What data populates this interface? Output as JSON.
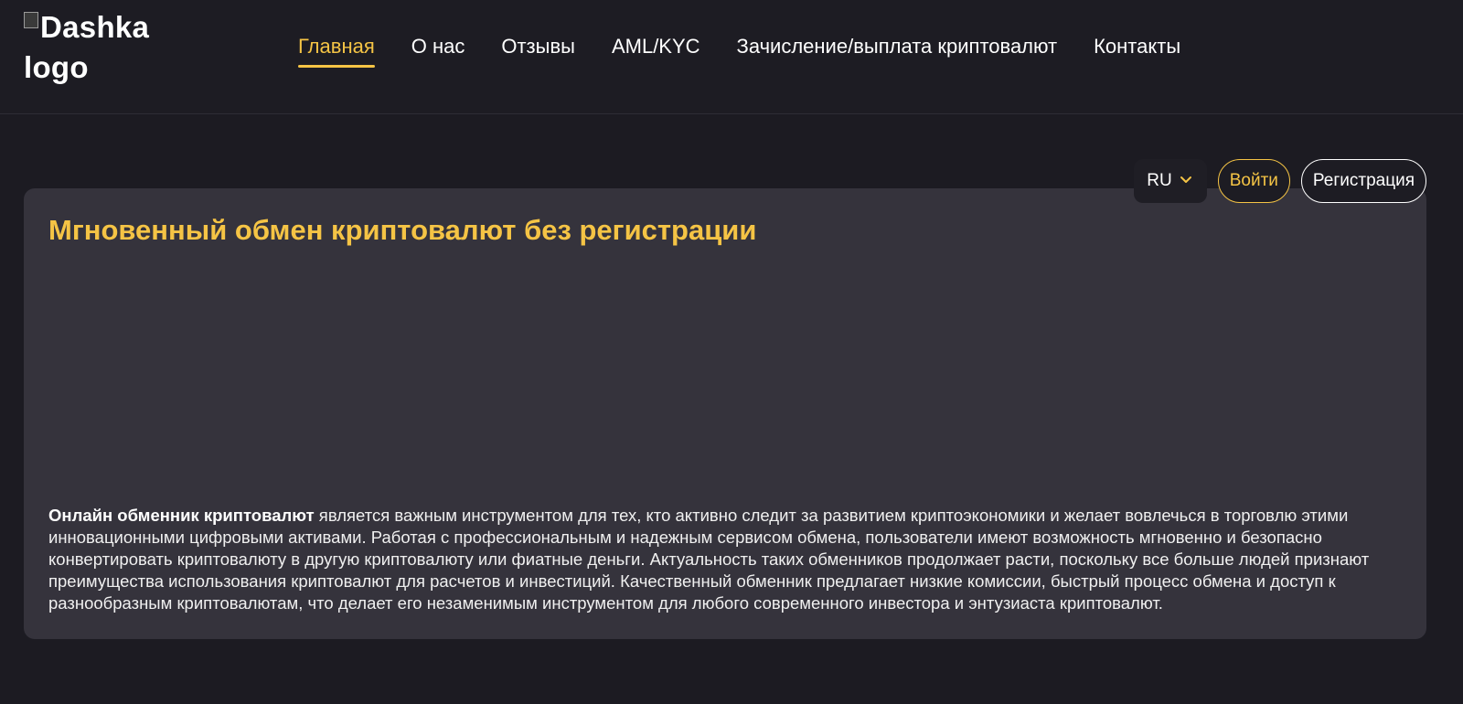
{
  "header": {
    "logo_alt": "Dashka logo",
    "nav": [
      {
        "label": "Главная",
        "active": true
      },
      {
        "label": "О нас"
      },
      {
        "label": "Отзывы"
      },
      {
        "label": "AML/KYC"
      },
      {
        "label": "Зачисление/выплата криптовалют"
      },
      {
        "label": "Контакты"
      }
    ]
  },
  "controls": {
    "lang": "RU",
    "login": "Войти",
    "register": "Регистрация"
  },
  "card": {
    "title": "Мгновенный обмен криптовалют без регистрации",
    "text_bold": "Онлайн обменник криптовалют",
    "text_rest": " является важным инструментом для тех, кто активно следит за развитием криптоэкономики и желает вовлечься в торговлю этими инновационными цифровыми активами. Работая с профессиональным и надежным сервисом обмена, пользователи имеют возможность мгновенно и безопасно конвертировать криптовалюту в другую криптовалюту или фиатные деньги. Актуальность таких обменников продолжает расти, поскольку все больше людей признают преимущества использования криптовалют для расчетов и инвестиций. Качественный обменник предлагает низкие комиссии, быстрый процесс обмена и доступ к разнообразным криптовалютам, что делает его незаменимым инструментом для любого современного инвестора и энтузиаста криптовалют."
  },
  "colors": {
    "accent": "#f5c445",
    "background": "#1c1b22",
    "card": "#35333c"
  },
  "icons": {
    "lang_dropdown": "chevron-down-icon",
    "logo": "broken-image-icon"
  }
}
